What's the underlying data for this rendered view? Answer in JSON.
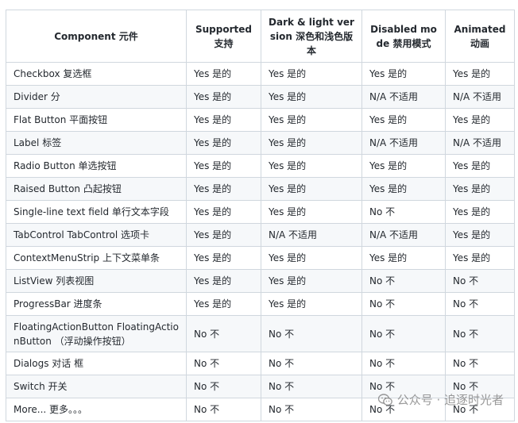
{
  "table": {
    "headers": [
      "Component 元件",
      "Supported 支持",
      "Dark & light version 深色和浅色版本",
      "Disabled mode 禁用模式",
      "Animated 动画"
    ],
    "rows": [
      [
        "Checkbox 复选框",
        "Yes 是的",
        "Yes 是的",
        "Yes 是的",
        "Yes 是的"
      ],
      [
        "Divider 分",
        "Yes 是的",
        "Yes 是的",
        "N/A 不适用",
        "N/A 不适用"
      ],
      [
        "Flat Button 平面按钮",
        "Yes 是的",
        "Yes 是的",
        "Yes 是的",
        "Yes 是的"
      ],
      [
        "Label 标签",
        "Yes 是的",
        "Yes 是的",
        "N/A 不适用",
        "N/A 不适用"
      ],
      [
        "Radio Button 单选按钮",
        "Yes 是的",
        "Yes 是的",
        "Yes 是的",
        "Yes 是的"
      ],
      [
        "Raised Button 凸起按钮",
        "Yes 是的",
        "Yes 是的",
        "Yes 是的",
        "Yes 是的"
      ],
      [
        "Single-line text field 单行文本字段",
        "Yes 是的",
        "Yes 是的",
        "No 不",
        "Yes 是的"
      ],
      [
        "TabControl TabControl 选项卡",
        "Yes 是的",
        "N/A 不适用",
        "N/A 不适用",
        "Yes 是的"
      ],
      [
        "ContextMenuStrip 上下文菜单条",
        "Yes 是的",
        "Yes 是的",
        "Yes 是的",
        "Yes 是的"
      ],
      [
        "ListView 列表视图",
        "Yes 是的",
        "Yes 是的",
        "No 不",
        "No 不"
      ],
      [
        "ProgressBar 进度条",
        "Yes 是的",
        "Yes 是的",
        "No 不",
        "No 不"
      ],
      [
        "FloatingActionButton FloatingActionButton （浮动操作按钮）",
        "No 不",
        "No 不",
        "No 不",
        "No 不"
      ],
      [
        "Dialogs 对话 框",
        "No 不",
        "No 不",
        "No 不",
        "No 不"
      ],
      [
        "Switch 开关",
        "No 不",
        "No 不",
        "No 不",
        "No 不"
      ],
      [
        "More... 更多。。。",
        "No 不",
        "No 不",
        "No 不",
        "No 不"
      ]
    ]
  },
  "watermark": {
    "text": "公众号 · 追逐时光者"
  }
}
